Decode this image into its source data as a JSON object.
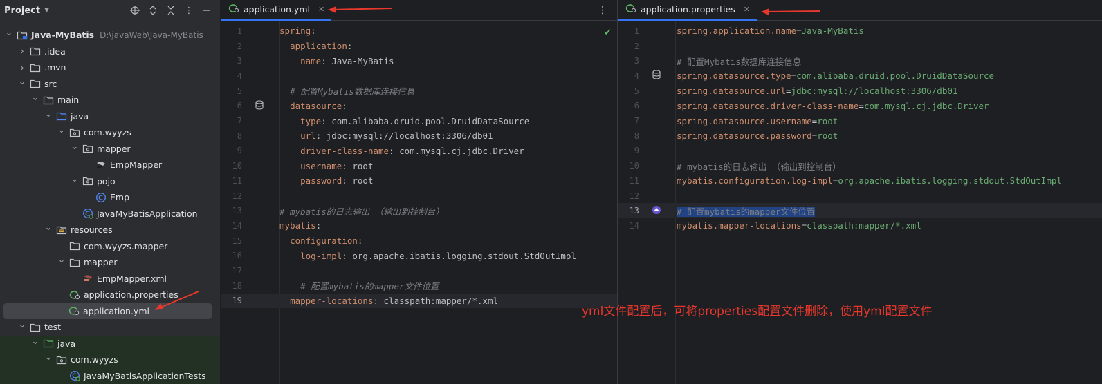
{
  "project_panel": {
    "title": "Project",
    "tree": [
      {
        "label": "Java-MyBatis",
        "path": "D:\\javaWeb\\Java-MyBatis",
        "depth": 0,
        "expanded": true,
        "icon": "module-folder-icon",
        "bold": true
      },
      {
        "label": ".idea",
        "depth": 1,
        "expanded": false,
        "icon": "folder-icon"
      },
      {
        "label": ".mvn",
        "depth": 1,
        "expanded": false,
        "icon": "folder-icon"
      },
      {
        "label": "src",
        "depth": 1,
        "expanded": true,
        "icon": "folder-icon"
      },
      {
        "label": "main",
        "depth": 2,
        "expanded": true,
        "icon": "folder-icon"
      },
      {
        "label": "java",
        "depth": 3,
        "expanded": true,
        "icon": "source-folder-icon"
      },
      {
        "label": "com.wyyzs",
        "depth": 4,
        "expanded": true,
        "icon": "package-icon"
      },
      {
        "label": "mapper",
        "depth": 5,
        "expanded": true,
        "icon": "package-icon"
      },
      {
        "label": "EmpMapper",
        "depth": 6,
        "icon": "mybatis-mapper-icon"
      },
      {
        "label": "pojo",
        "depth": 5,
        "expanded": true,
        "icon": "package-icon"
      },
      {
        "label": "Emp",
        "depth": 6,
        "icon": "class-icon"
      },
      {
        "label": "JavaMyBatisApplication",
        "depth": 5,
        "icon": "spring-boot-app-icon"
      },
      {
        "label": "resources",
        "depth": 3,
        "expanded": true,
        "icon": "resources-folder-icon"
      },
      {
        "label": "com.wyyzs.mapper",
        "depth": 4,
        "icon": "folder-icon"
      },
      {
        "label": "mapper",
        "depth": 4,
        "expanded": true,
        "icon": "folder-icon"
      },
      {
        "label": "EmpMapper.xml",
        "depth": 5,
        "icon": "mybatis-xml-icon"
      },
      {
        "label": "application.properties",
        "depth": 4,
        "icon": "spring-config-icon"
      },
      {
        "label": "application.yml",
        "depth": 4,
        "icon": "spring-config-icon",
        "selected": true
      },
      {
        "label": "test",
        "depth": 1,
        "expanded": true,
        "icon": "folder-icon"
      },
      {
        "label": "java",
        "depth": 2,
        "expanded": true,
        "icon": "test-folder-icon",
        "green": true
      },
      {
        "label": "com.wyyzs",
        "depth": 3,
        "expanded": true,
        "icon": "package-icon",
        "green": true
      },
      {
        "label": "JavaMyBatisApplicationTests",
        "depth": 4,
        "icon": "spring-boot-app-icon",
        "green": true
      }
    ]
  },
  "editor_yml": {
    "tab_label": "application.yml",
    "current_line": 19,
    "lines": [
      [
        {
          "t": "spring",
          "c": "k"
        },
        {
          "t": ":",
          "c": "v"
        }
      ],
      [
        {
          "t": "  "
        },
        {
          "t": "application",
          "c": "k"
        },
        {
          "t": ":",
          "c": "v"
        }
      ],
      [
        {
          "t": "    "
        },
        {
          "t": "name",
          "c": "k"
        },
        {
          "t": ": Java-MyBatis",
          "c": "v"
        }
      ],
      [],
      [
        {
          "t": "  "
        },
        {
          "t": "# 配置Mybatis数据库连接信息",
          "c": "c"
        }
      ],
      [
        {
          "t": "  "
        },
        {
          "t": "datasource",
          "c": "k"
        },
        {
          "t": ":",
          "c": "v"
        }
      ],
      [
        {
          "t": "    "
        },
        {
          "t": "type",
          "c": "k"
        },
        {
          "t": ": com.alibaba.druid.pool.DruidDataSource",
          "c": "v"
        }
      ],
      [
        {
          "t": "    "
        },
        {
          "t": "url",
          "c": "k"
        },
        {
          "t": ": jdbc:mysql://localhost:3306/db01",
          "c": "v"
        }
      ],
      [
        {
          "t": "    "
        },
        {
          "t": "driver-class-name",
          "c": "k"
        },
        {
          "t": ": com.mysql.cj.jdbc.Driver",
          "c": "v"
        }
      ],
      [
        {
          "t": "    "
        },
        {
          "t": "username",
          "c": "k"
        },
        {
          "t": ": root",
          "c": "v"
        }
      ],
      [
        {
          "t": "    "
        },
        {
          "t": "password",
          "c": "k"
        },
        {
          "t": ": root",
          "c": "v"
        }
      ],
      [],
      [
        {
          "t": "# mybatis的日志输出 （输出到控制台）",
          "c": "c"
        }
      ],
      [
        {
          "t": "mybatis",
          "c": "k"
        },
        {
          "t": ":",
          "c": "v"
        }
      ],
      [
        {
          "t": "  "
        },
        {
          "t": "configuration",
          "c": "k"
        },
        {
          "t": ":",
          "c": "v"
        }
      ],
      [
        {
          "t": "    "
        },
        {
          "t": "log-impl",
          "c": "k"
        },
        {
          "t": ": org.apache.ibatis.logging.stdout.StdOutImpl",
          "c": "v"
        }
      ],
      [],
      [
        {
          "t": "    "
        },
        {
          "t": "# 配置mybatis的mapper文件位置",
          "c": "c"
        }
      ],
      [
        {
          "t": "  "
        },
        {
          "t": "mapper-locations",
          "c": "k"
        },
        {
          "t": ": classpath:mapper/*.xml",
          "c": "v"
        }
      ]
    ]
  },
  "editor_props": {
    "tab_label": "application.properties",
    "current_line": 13,
    "lines": [
      [
        {
          "t": "spring.application.name",
          "c": "pk"
        },
        {
          "t": "=",
          "c": "pe"
        },
        {
          "t": "Java-MyBatis",
          "c": "pv"
        }
      ],
      [],
      [
        {
          "t": "# 配置Mybatis数据库连接信息",
          "c": "pc"
        }
      ],
      [
        {
          "t": "spring.datasource.type",
          "c": "pk"
        },
        {
          "t": "=",
          "c": "pe"
        },
        {
          "t": "com.alibaba.druid.pool.DruidDataSource",
          "c": "pv"
        }
      ],
      [
        {
          "t": "spring.datasource.url",
          "c": "pk"
        },
        {
          "t": "=",
          "c": "pe"
        },
        {
          "t": "jdbc:mysql://localhost:3306/db01",
          "c": "pv"
        }
      ],
      [
        {
          "t": "spring.datasource.driver-class-name",
          "c": "pk"
        },
        {
          "t": "=",
          "c": "pe"
        },
        {
          "t": "com.mysql.cj.jdbc.Driver",
          "c": "pv"
        }
      ],
      [
        {
          "t": "spring.datasource.username",
          "c": "pk"
        },
        {
          "t": "=",
          "c": "pe"
        },
        {
          "t": "root",
          "c": "pv"
        }
      ],
      [
        {
          "t": "spring.datasource.password",
          "c": "pk"
        },
        {
          "t": "=",
          "c": "pe"
        },
        {
          "t": "root",
          "c": "pv"
        }
      ],
      [],
      [
        {
          "t": "# mybatis的日志输出 （输出到控制台）",
          "c": "pc"
        }
      ],
      [
        {
          "t": "mybatis.configuration.log-impl",
          "c": "pk"
        },
        {
          "t": "=",
          "c": "pe"
        },
        {
          "t": "org.apache.ibatis.logging.stdout.StdOutImpl",
          "c": "pv"
        }
      ],
      [],
      [
        {
          "t": "# 配置mybatis的mapper文件位置",
          "c": "pc hl"
        }
      ],
      [
        {
          "t": "mybatis.mapper-locations",
          "c": "pk"
        },
        {
          "t": "=",
          "c": "pe"
        },
        {
          "t": "classpath:mapper/*.xml",
          "c": "pv"
        }
      ]
    ]
  },
  "annotation_text": "yml文件配置后，可将properties配置文件删除，使用yml配置文件",
  "colors": {
    "annotation": "#e8382e",
    "accent": "#3574f0"
  }
}
